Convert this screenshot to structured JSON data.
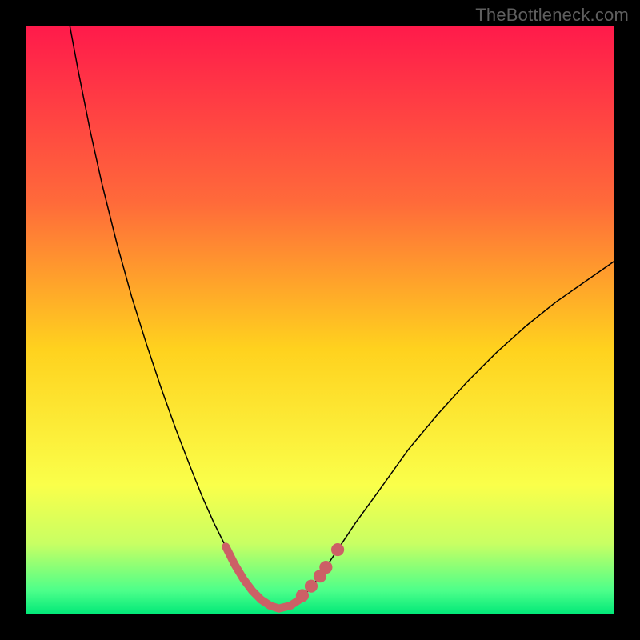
{
  "watermark": "TheBottleneck.com",
  "chart_data": {
    "type": "line",
    "title": "",
    "xlabel": "",
    "ylabel": "",
    "xlim": [
      0,
      100
    ],
    "ylim": [
      0,
      100
    ],
    "background_gradient": {
      "stops": [
        {
          "pos": 0.0,
          "color": "#ff1a4b"
        },
        {
          "pos": 0.3,
          "color": "#ff6a3a"
        },
        {
          "pos": 0.55,
          "color": "#ffd21e"
        },
        {
          "pos": 0.78,
          "color": "#faff4a"
        },
        {
          "pos": 0.88,
          "color": "#c8ff63"
        },
        {
          "pos": 0.96,
          "color": "#4cff8a"
        },
        {
          "pos": 1.0,
          "color": "#00e878"
        }
      ]
    },
    "series": [
      {
        "name": "curve",
        "stroke": "#000000",
        "stroke_width": 1.5,
        "points": [
          {
            "x": 7.5,
            "y": 100.0
          },
          {
            "x": 9.0,
            "y": 92.0
          },
          {
            "x": 11.0,
            "y": 82.0
          },
          {
            "x": 13.0,
            "y": 73.0
          },
          {
            "x": 15.5,
            "y": 63.0
          },
          {
            "x": 18.0,
            "y": 54.0
          },
          {
            "x": 20.5,
            "y": 46.0
          },
          {
            "x": 23.0,
            "y": 38.5
          },
          {
            "x": 25.5,
            "y": 31.5
          },
          {
            "x": 28.0,
            "y": 25.0
          },
          {
            "x": 30.0,
            "y": 20.0
          },
          {
            "x": 32.0,
            "y": 15.5
          },
          {
            "x": 34.0,
            "y": 11.5
          },
          {
            "x": 35.5,
            "y": 8.5
          },
          {
            "x": 37.0,
            "y": 6.0
          },
          {
            "x": 38.5,
            "y": 4.0
          },
          {
            "x": 40.0,
            "y": 2.5
          },
          {
            "x": 41.5,
            "y": 1.5
          },
          {
            "x": 43.0,
            "y": 1.0
          },
          {
            "x": 45.0,
            "y": 1.5
          },
          {
            "x": 46.5,
            "y": 2.5
          },
          {
            "x": 48.0,
            "y": 4.0
          },
          {
            "x": 50.0,
            "y": 6.5
          },
          {
            "x": 53.0,
            "y": 11.0
          },
          {
            "x": 56.0,
            "y": 15.5
          },
          {
            "x": 60.0,
            "y": 21.0
          },
          {
            "x": 65.0,
            "y": 28.0
          },
          {
            "x": 70.0,
            "y": 34.0
          },
          {
            "x": 75.0,
            "y": 39.5
          },
          {
            "x": 80.0,
            "y": 44.5
          },
          {
            "x": 85.0,
            "y": 49.0
          },
          {
            "x": 90.0,
            "y": 53.0
          },
          {
            "x": 95.0,
            "y": 56.5
          },
          {
            "x": 100.0,
            "y": 60.0
          }
        ]
      },
      {
        "name": "highlight-left",
        "stroke": "#cc6066",
        "stroke_width": 10,
        "linecap": "round",
        "points": [
          {
            "x": 34.0,
            "y": 11.5
          },
          {
            "x": 35.5,
            "y": 8.5
          },
          {
            "x": 37.0,
            "y": 6.0
          },
          {
            "x": 38.5,
            "y": 4.0
          },
          {
            "x": 40.0,
            "y": 2.5
          },
          {
            "x": 41.5,
            "y": 1.5
          }
        ]
      },
      {
        "name": "highlight-bottom",
        "stroke": "#cc6066",
        "stroke_width": 10,
        "linecap": "round",
        "points": [
          {
            "x": 40.0,
            "y": 2.5
          },
          {
            "x": 41.5,
            "y": 1.5
          },
          {
            "x": 43.0,
            "y": 1.0
          },
          {
            "x": 45.0,
            "y": 1.5
          },
          {
            "x": 46.5,
            "y": 2.5
          }
        ]
      }
    ],
    "dots": {
      "fill": "#cc6066",
      "r_percent": 1.1,
      "points": [
        {
          "x": 47.0,
          "y": 3.2
        },
        {
          "x": 48.5,
          "y": 4.8
        },
        {
          "x": 50.0,
          "y": 6.5
        },
        {
          "x": 51.0,
          "y": 8.0
        },
        {
          "x": 53.0,
          "y": 11.0
        }
      ]
    }
  }
}
